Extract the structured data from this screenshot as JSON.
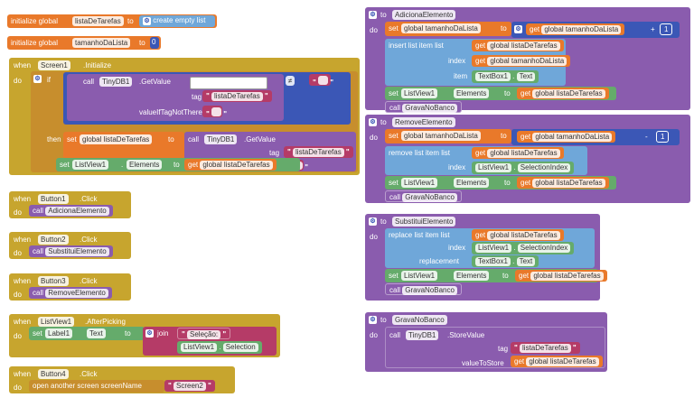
{
  "blocks": {
    "g1": {
      "kw": "initialize global",
      "name": "listaDeTarefas",
      "to": "to",
      "val": "create empty list"
    },
    "g2": {
      "kw": "initialize global",
      "name": "tamanhoDaLista",
      "to": "to",
      "val": "0"
    },
    "init": {
      "when": "when",
      "comp": "Screen1",
      "event": ".Initialize",
      "do": "do",
      "if": "if",
      "call": "call",
      "db": "TinyDB1",
      "getvalue": ".GetValue",
      "tag": "tag",
      "tagval": "listaDeTarefas",
      "vitn": "valueIfTagNotThere",
      "neq": "≠",
      "then": "then",
      "set": "set",
      "setvar": "global listaDeTarefas",
      "to": "to",
      "call2": "call",
      "db2": "TinyDB1",
      "getvalue2": ".GetValue",
      "tag2": "tag",
      "tagval2": "listaDeTarefas",
      "vitn2": "valueIfTagNotThere",
      "set2": "set",
      "lv": "ListView1",
      "elements": "Elements",
      "to2": "to",
      "get": "get",
      "getvar": "global listaDeTarefas"
    },
    "b1": {
      "when": "when",
      "comp": "Button1",
      "event": ".Click",
      "do": "do",
      "call": "call",
      "proc": "AdicionaElemento"
    },
    "b2": {
      "when": "when",
      "comp": "Button2",
      "event": ".Click",
      "do": "do",
      "call": "call",
      "proc": "SubstituiElemento"
    },
    "b3": {
      "when": "when",
      "comp": "Button3",
      "event": ".Click",
      "do": "do",
      "call": "call",
      "proc": "RemoveElemento"
    },
    "lvp": {
      "when": "when",
      "comp": "ListView1",
      "event": ".AfterPicking",
      "do": "do",
      "set": "set",
      "lbl": "Label1",
      "text": "Text",
      "to": "to",
      "join": "join",
      "sel": "Seleção: ",
      "lv": "ListView1",
      "selection": "Selection"
    },
    "b4": {
      "when": "when",
      "comp": "Button4",
      "event": ".Click",
      "do": "do",
      "open": "open another screen  screenName",
      "screen": "Screen2"
    },
    "add": {
      "to": "to",
      "name": "AdicionaElemento",
      "do": "do",
      "set": "set",
      "var": "global tamanhoDaLista",
      "to2": "to",
      "get": "get",
      "getvar": "global tamanhoDaLista",
      "plus": "+",
      "one": "1",
      "insert": "insert list item  list",
      "get2": "get",
      "getvar2": "global listaDeTarefas",
      "index": "index",
      "get3": "get",
      "getvar3": "global tamanhoDaLista",
      "item": "item",
      "tb": "TextBox1",
      "text": "Text",
      "set2": "set",
      "lv": "ListView1",
      "elements": "Elements",
      "to3": "to",
      "get4": "get",
      "getvar4": "global listaDeTarefas",
      "call": "call",
      "proc": "GravaNoBanco"
    },
    "rem": {
      "to": "to",
      "name": "RemoveElemento",
      "do": "do",
      "set": "set",
      "var": "global tamanhoDaLista",
      "to2": "to",
      "get": "get",
      "getvar": "global tamanhoDaLista",
      "minus": "-",
      "one": "1",
      "remove": "remove list item  list",
      "get2": "get",
      "getvar2": "global listaDeTarefas",
      "index": "index",
      "lv": "ListView1",
      "selidx": "SelectionIndex",
      "set2": "set",
      "lv2": "ListView1",
      "elements": "Elements",
      "to3": "to",
      "get3": "get",
      "getvar3": "global listaDeTarefas",
      "call": "call",
      "proc": "GravaNoBanco"
    },
    "sub": {
      "to": "to",
      "name": "SubstituiElemento",
      "do": "do",
      "replace": "replace list item  list",
      "get": "get",
      "getvar": "global listaDeTarefas",
      "index": "index",
      "lv": "ListView1",
      "selidx": "SelectionIndex",
      "replacement": "replacement",
      "tb": "TextBox1",
      "text": "Text",
      "set": "set",
      "lv2": "ListView1",
      "elements": "Elements",
      "to2": "to",
      "get2": "get",
      "getvar2": "global listaDeTarefas",
      "call": "call",
      "proc": "GravaNoBanco"
    },
    "grava": {
      "to": "to",
      "name": "GravaNoBanco",
      "do": "do",
      "call": "call",
      "db": "TinyDB1",
      "store": ".StoreValue",
      "tag": "tag",
      "tagval": "listaDeTarefas",
      "vts": "valueToStore",
      "get": "get",
      "getvar": "global listaDeTarefas"
    }
  }
}
